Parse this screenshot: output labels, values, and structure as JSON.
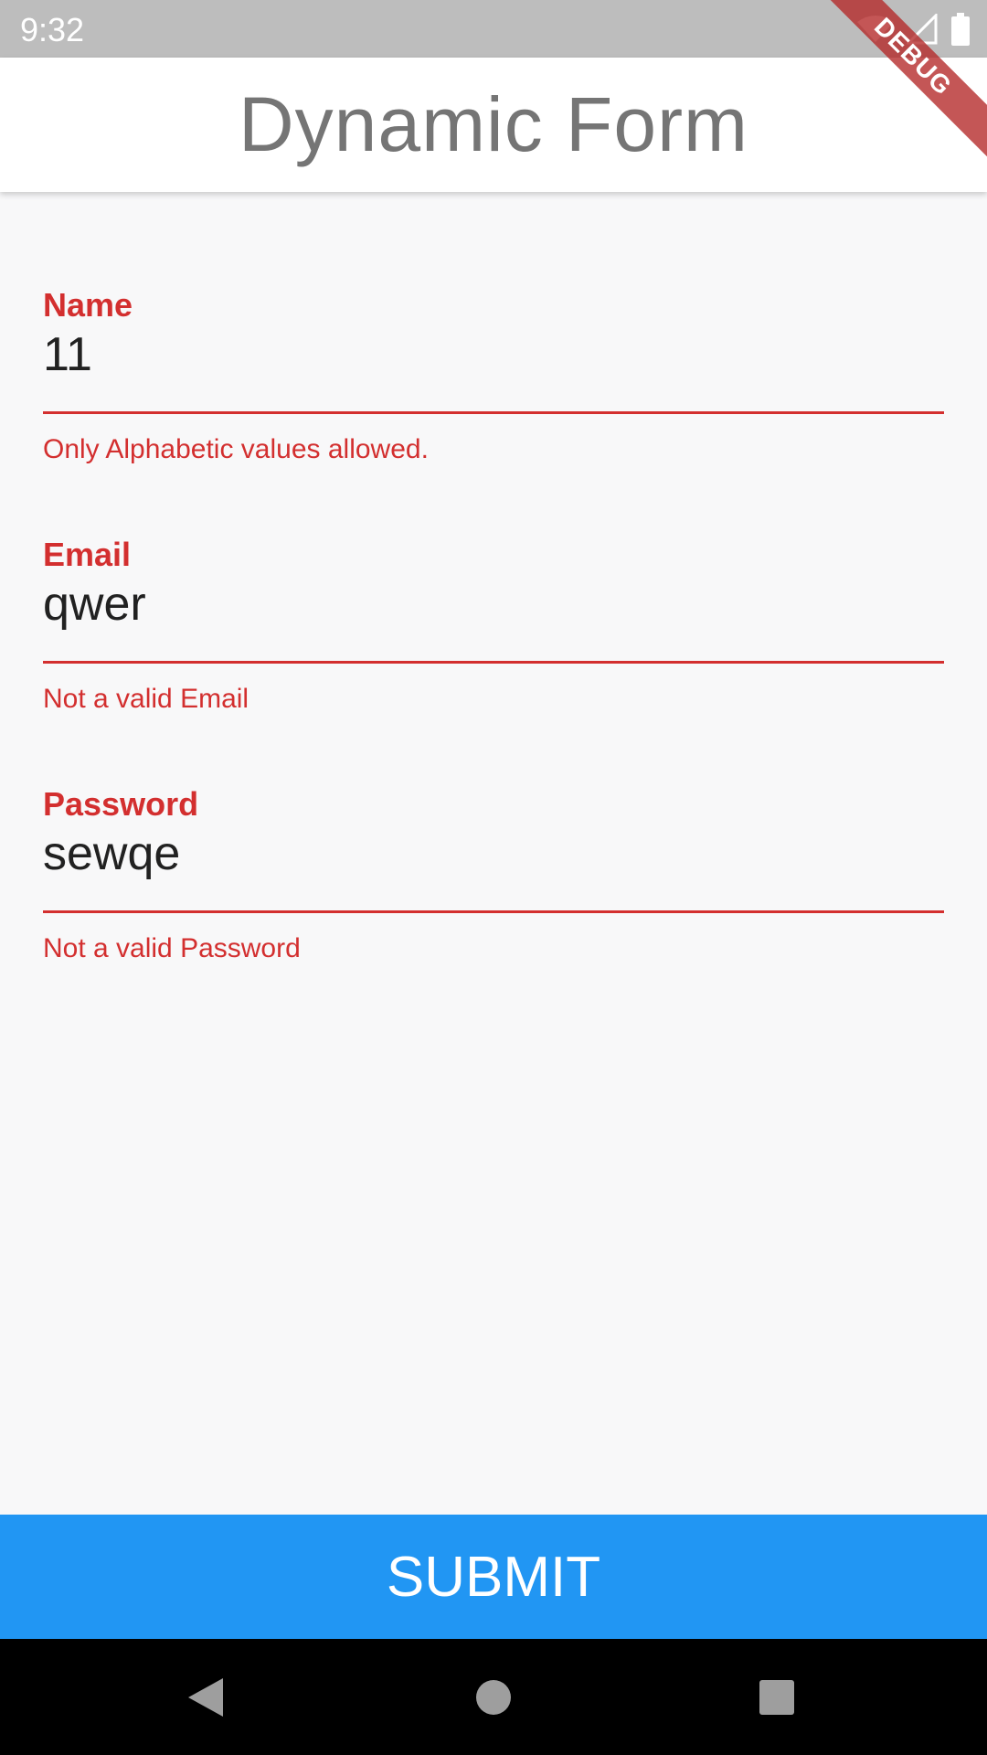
{
  "status_bar": {
    "time": "9:32",
    "icons": [
      "wifi-icon",
      "signal-icon",
      "battery-icon"
    ]
  },
  "debug_banner": "DEBUG",
  "app_bar": {
    "title": "Dynamic Form"
  },
  "form": {
    "fields": [
      {
        "label": "Name",
        "value": "11",
        "error": "Only Alphabetic values allowed."
      },
      {
        "label": "Email",
        "value": "qwer",
        "error": "Not a valid Email"
      },
      {
        "label": "Password",
        "value": "sewqe",
        "error": "Not a valid Password"
      }
    ]
  },
  "submit": {
    "label": "SUBMIT"
  },
  "nav_bar": {
    "buttons": [
      "back-icon",
      "home-icon",
      "recents-icon"
    ]
  },
  "colors": {
    "error": "#d32f2f",
    "primary": "#2196f3",
    "status_bar": "#bdbdbd",
    "title": "#757575"
  }
}
